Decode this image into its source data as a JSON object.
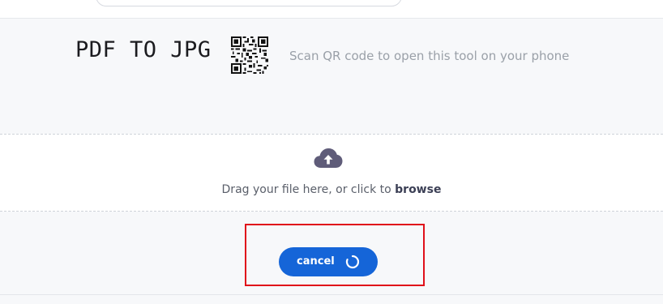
{
  "header": {
    "title": "PDF TO JPG",
    "qr_caption": "Scan QR code to open this tool on your phone",
    "qr_icon": "qr-code-icon"
  },
  "dropzone": {
    "icon": "cloud-upload-icon",
    "text_prefix": "Drag your file here, or click to ",
    "browse_label": "browse"
  },
  "actions": {
    "cancel_label": "cancel",
    "spinner_icon": "loading-spinner-icon"
  },
  "colors": {
    "accent": "#1565d8",
    "highlight": "#e0101a",
    "icon": "#5f5c79"
  }
}
